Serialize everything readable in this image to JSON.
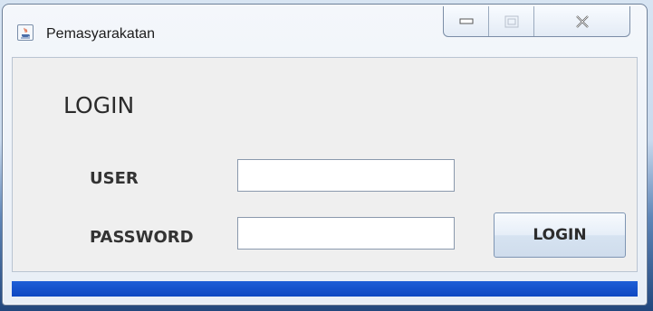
{
  "window": {
    "title": "Pemasyarakatan",
    "app_icon": "java-cup-icon",
    "controls": {
      "minimize": "minimize-icon",
      "maximize": "maximize-icon",
      "close": "close-icon"
    }
  },
  "form": {
    "heading": "LOGIN",
    "user_label": "USER",
    "user_value": "",
    "password_label": "PASSWORD",
    "password_value": "",
    "login_button": "LOGIN"
  },
  "colors": {
    "bottom_bar": "#0d47c2",
    "panel_background": "#efefef"
  }
}
